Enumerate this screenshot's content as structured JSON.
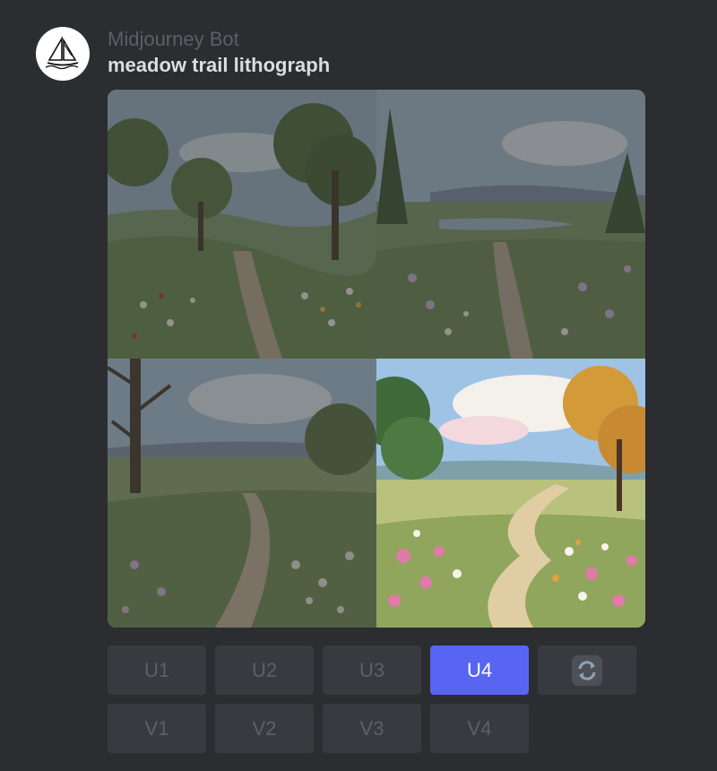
{
  "message": {
    "author": "Midjourney Bot",
    "prompt": "meadow trail lithograph",
    "avatar_icon": "sailboat-icon"
  },
  "image_grid": {
    "tiles": [
      {
        "index": 1,
        "description": "meadow path with trees and wildflowers",
        "selected": false
      },
      {
        "index": 2,
        "description": "meadow path with river and distant hills",
        "selected": false
      },
      {
        "index": 3,
        "description": "winding trail with bare tree and white flowers",
        "selected": false
      },
      {
        "index": 4,
        "description": "bright meadow trail with pink and white flowers",
        "selected": true
      }
    ]
  },
  "buttons": {
    "upscale": [
      "U1",
      "U2",
      "U3",
      "U4"
    ],
    "variation": [
      "V1",
      "V2",
      "V3",
      "V4"
    ],
    "active": "U4",
    "reroll_icon": "refresh-icon"
  },
  "colors": {
    "background": "#2b2d31",
    "button": "#383a40",
    "button_active": "#5865f2"
  }
}
